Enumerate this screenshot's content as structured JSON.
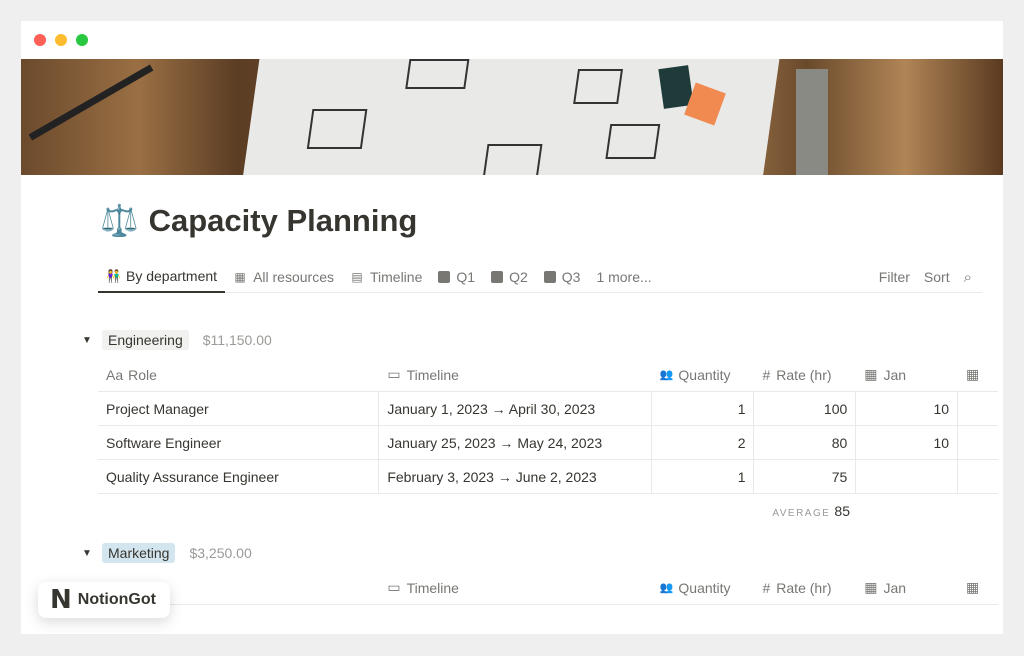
{
  "window": {
    "controls": [
      "close",
      "minimize",
      "maximize"
    ],
    "colors": {
      "close": "#fe5f57",
      "minimize": "#febc2e",
      "maximize": "#28c840"
    }
  },
  "page": {
    "icon": "⚖️",
    "title": "Capacity Planning"
  },
  "tabs": [
    {
      "icon": "people-icon",
      "label": "By department",
      "active": true
    },
    {
      "icon": "table-icon",
      "label": "All resources"
    },
    {
      "icon": "timeline-icon",
      "label": "Timeline"
    },
    {
      "icon": "dice-one-icon",
      "label": "Q1"
    },
    {
      "icon": "dice-two-icon",
      "label": "Q2"
    },
    {
      "icon": "dice-three-icon",
      "label": "Q3"
    },
    {
      "label": "1 more..."
    }
  ],
  "toolbar": {
    "filter": "Filter",
    "sort": "Sort"
  },
  "columns": {
    "role": "Role",
    "role_icon": "Aa",
    "timeline": "Timeline",
    "quantity": "Quantity",
    "rate": "Rate (hr)",
    "jan": "Jan"
  },
  "groups": [
    {
      "name": "Engineering",
      "total": "$11,150.00",
      "tag_color": "#f1f1ef",
      "rows": [
        {
          "role": "Project Manager",
          "timeline": "January 1, 2023 → April 30, 2023",
          "quantity": "1",
          "rate": "100",
          "jan": "10"
        },
        {
          "role": "Software Engineer",
          "timeline": "January 25, 2023 → May 24, 2023",
          "quantity": "2",
          "rate": "80",
          "jan": "10"
        },
        {
          "role": "Quality Assurance Engineer",
          "timeline": "February 3, 2023 → June 2, 2023",
          "quantity": "1",
          "rate": "75",
          "jan": ""
        }
      ],
      "footer": {
        "label": "AVERAGE",
        "value": "85"
      }
    },
    {
      "name": "Marketing",
      "total": "$3,250.00",
      "tag_color": "#d3e5ef"
    }
  ],
  "watermark": {
    "logo": "N",
    "text": "NotionGot"
  }
}
